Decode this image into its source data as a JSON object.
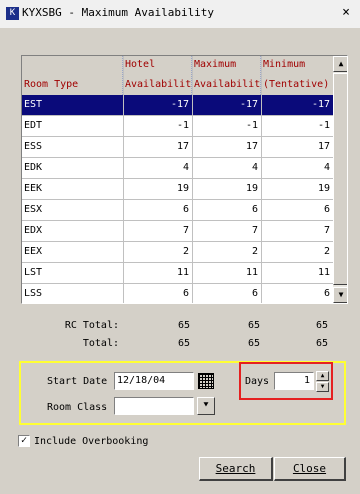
{
  "window": {
    "title": "KYXSBG - Maximum Availability",
    "app_icon_glyph": "K"
  },
  "table": {
    "columns": [
      {
        "line1": "",
        "line2": "Room Type"
      },
      {
        "line1": "Hotel",
        "line2": "Availability"
      },
      {
        "line1": "Maximum",
        "line2": "Availability"
      },
      {
        "line1": "Minimum",
        "line2": "(Tentative)"
      }
    ],
    "rows": [
      {
        "type": "EST",
        "hotel": "-17",
        "max": "-17",
        "min": "-17"
      },
      {
        "type": "EDT",
        "hotel": "-1",
        "max": "-1",
        "min": "-1"
      },
      {
        "type": "ESS",
        "hotel": "17",
        "max": "17",
        "min": "17"
      },
      {
        "type": "EDK",
        "hotel": "4",
        "max": "4",
        "min": "4"
      },
      {
        "type": "EEK",
        "hotel": "19",
        "max": "19",
        "min": "19"
      },
      {
        "type": "ESX",
        "hotel": "6",
        "max": "6",
        "min": "6"
      },
      {
        "type": "EDX",
        "hotel": "7",
        "max": "7",
        "min": "7"
      },
      {
        "type": "EEX",
        "hotel": "2",
        "max": "2",
        "min": "2"
      },
      {
        "type": "LST",
        "hotel": "11",
        "max": "11",
        "min": "11"
      },
      {
        "type": "LSS",
        "hotel": "6",
        "max": "6",
        "min": "6"
      }
    ],
    "selected_row": 0
  },
  "totals": {
    "rc_total_label": "RC Total:",
    "rc_total": [
      "65",
      "65",
      "65"
    ],
    "total_label": "Total:",
    "total": [
      "65",
      "65",
      "65"
    ]
  },
  "filters": {
    "start_date_label": "Start Date",
    "start_date": "12/18/04",
    "room_class_label": "Room Class",
    "room_class": "",
    "days_label": "Days",
    "days": "1"
  },
  "include_overbooking": {
    "label": "Include Overbooking",
    "checked": true
  },
  "buttons": {
    "search": "Search",
    "close": "Close"
  },
  "icons": {
    "close": "×",
    "scroll_up": "▲",
    "scroll_down": "▼",
    "dropdown": "⯆",
    "spin_up": "▲",
    "spin_down": "▼",
    "check": "✓"
  },
  "colors": {
    "header_text": "#a00000",
    "selection": "#0a0a7a",
    "highlight_box": "#ffff33",
    "callout_box": "#e52020"
  }
}
